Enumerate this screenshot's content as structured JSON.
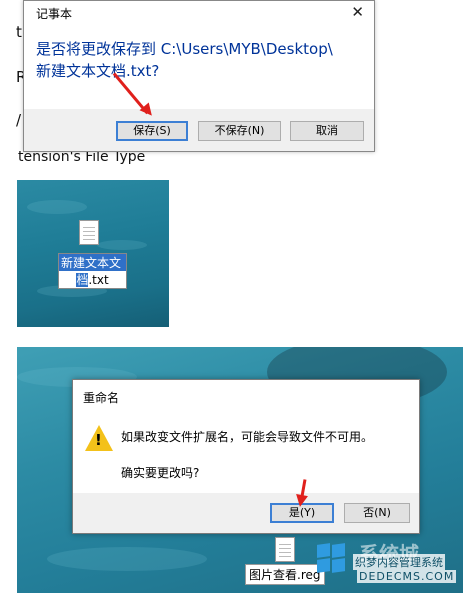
{
  "background_text": [
    "t",
    "R",
    "/",
    "tension's File Type"
  ],
  "notepad_dialog": {
    "title": "记事本",
    "close_glyph": "✕",
    "message_line1": "是否将更改保存到 C:\\Users\\MYB\\Desktop\\",
    "message_line2": "新建文本文档.txt?",
    "buttons": {
      "save": "保存(S)",
      "dont_save": "不保存(N)",
      "cancel": "取消"
    }
  },
  "desktop1": {
    "file_label_line1": "新建文本文",
    "file_label_sel": "档",
    "file_label_rest": ".txt"
  },
  "rename_dialog": {
    "title": "重命名",
    "message": "如果改变文件扩展名，可能会导致文件不可用。",
    "question": "确实要更改吗?",
    "buttons": {
      "yes": "是(Y)",
      "no": "否(N)"
    }
  },
  "desktop2": {
    "file_label": "图片查看.reg",
    "watermark_text": "织梦内容管理系统",
    "watermark_url": "DEDECMS.COM",
    "watermark_brand": "系统城"
  },
  "colors": {
    "arrow": "#e0201c",
    "selection": "#2f70c8",
    "warning": "#f3c11a"
  }
}
